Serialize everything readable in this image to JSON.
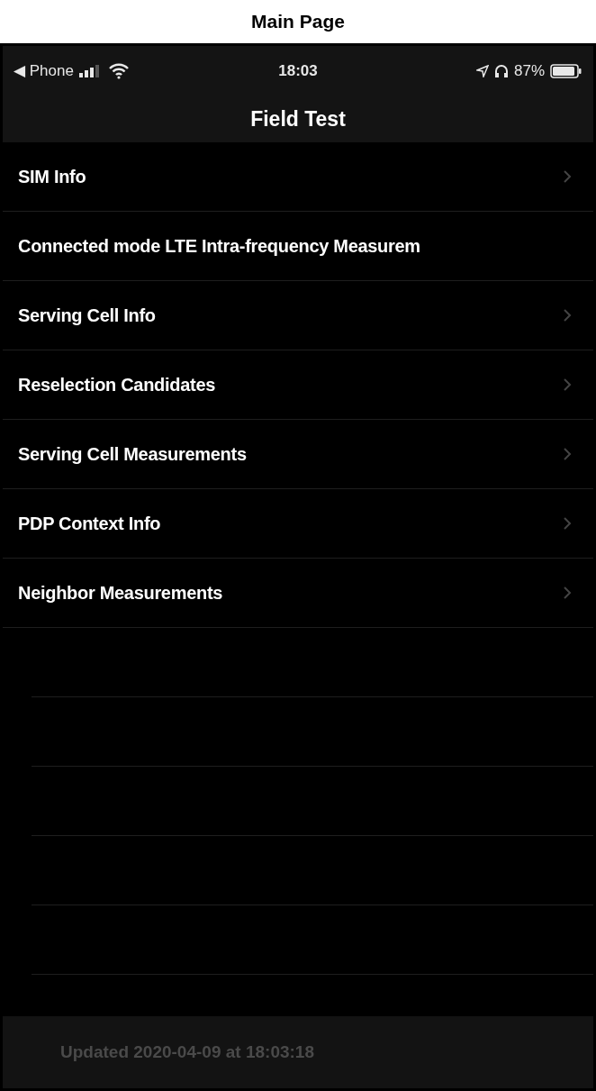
{
  "page_title": "Main Page",
  "status_bar": {
    "carrier": "◀ Phone",
    "time": "18:03",
    "battery": "87%"
  },
  "nav": {
    "title": "Field Test"
  },
  "rows": [
    {
      "label": "SIM Info",
      "chevron": true
    },
    {
      "label": "Connected mode LTE Intra-frequency Measurem",
      "chevron": false
    },
    {
      "label": "Serving Cell Info",
      "chevron": true
    },
    {
      "label": "Reselection Candidates",
      "chevron": true
    },
    {
      "label": "Serving Cell Measurements",
      "chevron": true
    },
    {
      "label": "PDP Context Info",
      "chevron": true
    },
    {
      "label": "Neighbor Measurements",
      "chevron": true
    }
  ],
  "footer": {
    "text": "Updated 2020-04-09 at 18:03:18"
  }
}
